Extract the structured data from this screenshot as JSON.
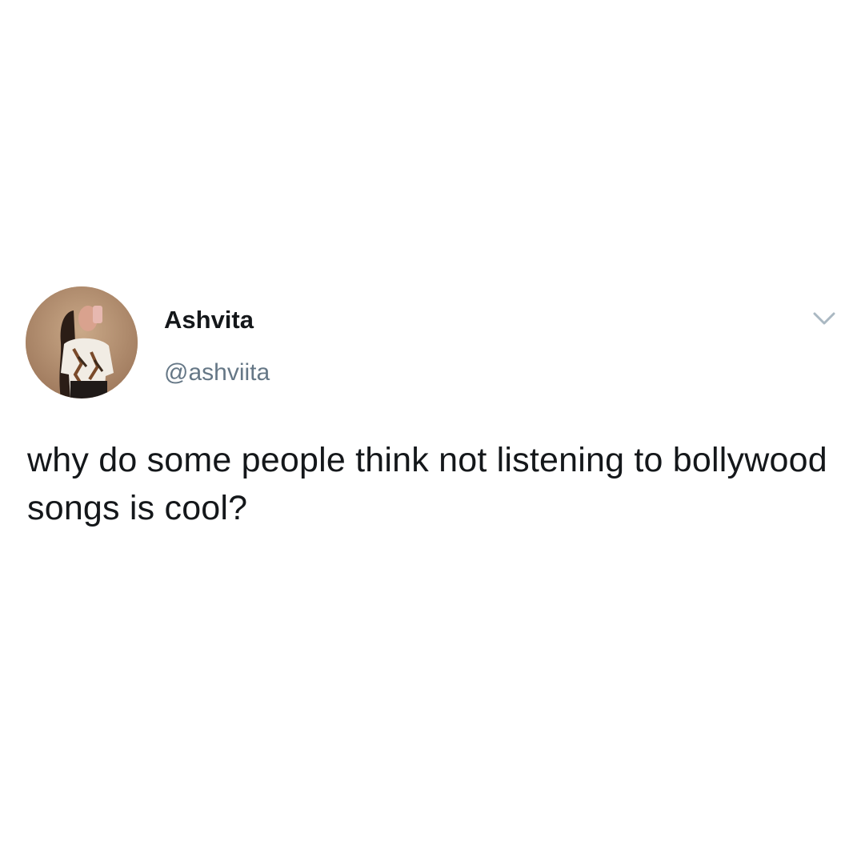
{
  "tweet": {
    "author": {
      "display_name": "Ashvita",
      "handle": "@ashviita",
      "avatar_icon": "profile-photo"
    },
    "menu_icon": "chevron-down-icon",
    "text": "why do some people think not listening to bollywood songs is cool?"
  },
  "colors": {
    "background": "#ffffff",
    "primary_text": "#14171a",
    "secondary_text": "#657786",
    "caret": "#aab8c2"
  }
}
